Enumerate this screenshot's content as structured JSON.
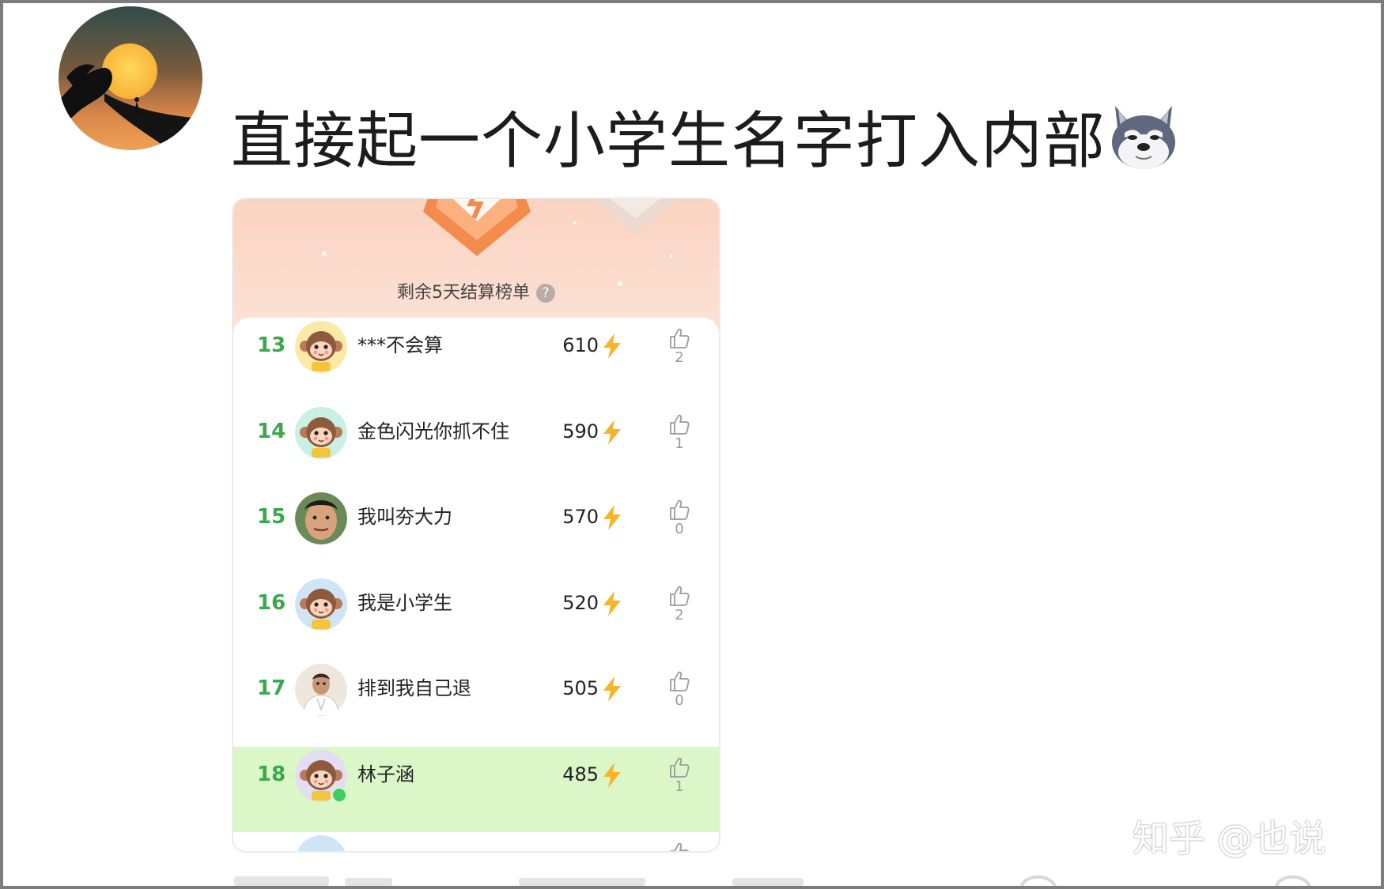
{
  "post": {
    "text": "直接起一个小学生名字打入内部",
    "emoji": "wolf-emoji"
  },
  "leaderboard": {
    "settlement_text": "剩余5天结算榜单",
    "help_glyph": "?",
    "rows": [
      {
        "rank": "13",
        "name": "***不会算",
        "score": "610",
        "likes": "2",
        "avatar": "monkey-avatar",
        "avatar_bg": "#fde9a6",
        "highlight": false
      },
      {
        "rank": "14",
        "name": "金色闪光你抓不住",
        "score": "590",
        "likes": "1",
        "avatar": "monkey-avatar",
        "avatar_bg": "#c9f0e4",
        "highlight": false
      },
      {
        "rank": "15",
        "name": "我叫夯大力",
        "score": "570",
        "likes": "0",
        "avatar": "person-avatar",
        "avatar_bg": "#d8a27c",
        "highlight": false
      },
      {
        "rank": "16",
        "name": "我是小学生",
        "score": "520",
        "likes": "2",
        "avatar": "monkey-avatar",
        "avatar_bg": "#cfe5f6",
        "highlight": false
      },
      {
        "rank": "17",
        "name": "排到我自己退",
        "score": "505",
        "likes": "0",
        "avatar": "person-avatar",
        "avatar_bg": "#efe6dc",
        "highlight": false
      },
      {
        "rank": "18",
        "name": "林子涵",
        "score": "485",
        "likes": "1",
        "avatar": "monkey-avatar",
        "avatar_bg": "#e2ddf2",
        "highlight": true
      }
    ]
  },
  "watermark": "知乎 @也说",
  "colors": {
    "rank_green": "#3aa84c",
    "highlight_row": "#dbf7c8",
    "header_peach": "#fbd3c1",
    "bolt_yellow": "#f6b529"
  }
}
